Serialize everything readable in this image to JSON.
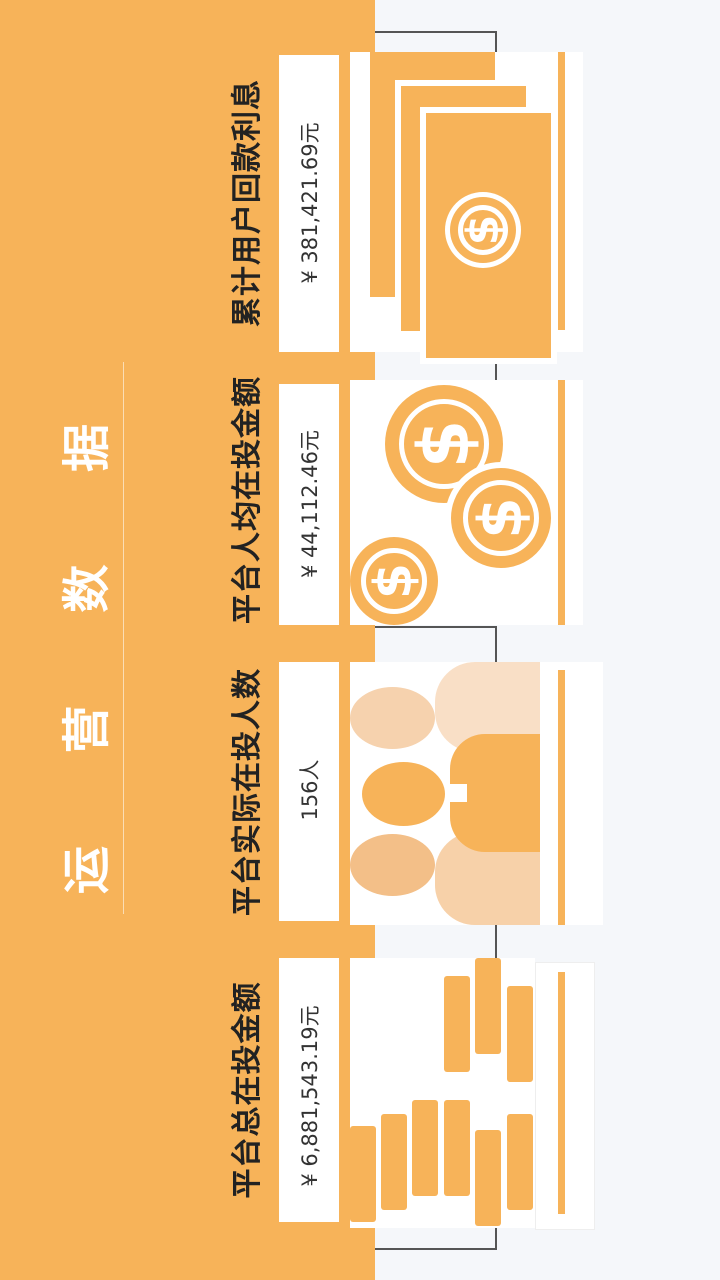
{
  "title": "运 营 数 据",
  "metrics": [
    {
      "label": "平台总在投金额",
      "value": "¥ 6,881,543.19元"
    },
    {
      "label": "平台实际在投人数",
      "value": "156人"
    },
    {
      "label": "平台人均在投金额",
      "value": "¥ 44,112.46元"
    },
    {
      "label": "累计用户回款利息",
      "value": "¥ 381,421.69元"
    }
  ],
  "colors": {
    "accent": "#f7b359",
    "text": "#222222",
    "panel_bg": "#f5f7fa"
  },
  "icons": [
    "coin-stacks-icon",
    "people-icon",
    "coins-icon",
    "banknotes-icon"
  ]
}
